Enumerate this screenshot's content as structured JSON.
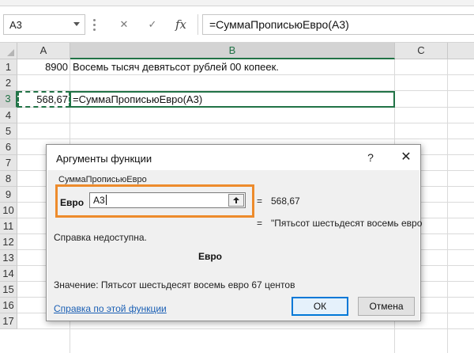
{
  "namebox": {
    "value": "A3"
  },
  "formula_bar": {
    "cancel_icon": "✕",
    "enter_icon": "✓",
    "fx_label": "fx",
    "formula": "=СуммаПрописьюЕвро(A3)"
  },
  "sheet": {
    "columns": [
      "A",
      "B",
      "C"
    ],
    "active_column": "B",
    "rows": [
      "1",
      "2",
      "3",
      "4",
      "5",
      "6",
      "7",
      "8",
      "9",
      "10",
      "11",
      "12",
      "13",
      "14",
      "15",
      "16",
      "17"
    ],
    "active_row": "3",
    "cells": {
      "a1": "8900",
      "b1": "Восемь тысяч девятьсот рублей  00 копеек.",
      "a3": "568,67",
      "b3": "=СуммаПрописьюЕвро(A3)"
    }
  },
  "dialog": {
    "title": "Аргументы функции",
    "help_icon": "?",
    "close_icon": "✕",
    "function_name": "СуммаПрописьюЕвро",
    "arg_label": "Евро",
    "arg_value": "A3",
    "eq": "=",
    "arg_result": "568,67",
    "func_result": "\"Пятьсот шестьдесят восемь евро",
    "help_unavailable": "Справка недоступна.",
    "arg_description": "Евро",
    "value_line": "Значение:   Пятьсот шестьдесят восемь евро 67 центов",
    "help_link": "Справка по этой функции",
    "ok": "ОК",
    "cancel": "Отмена"
  },
  "colors": {
    "excel_green": "#217346",
    "highlight_orange": "#ed8b2c",
    "link_blue": "#1a5fb4",
    "ok_border": "#0078d7"
  }
}
